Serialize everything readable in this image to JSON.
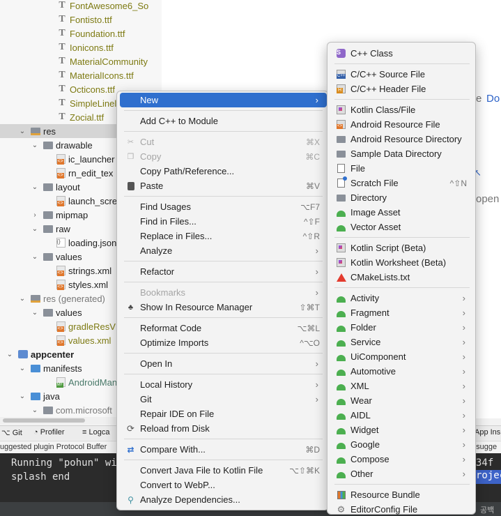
{
  "tree": {
    "rows": [
      {
        "label": "FontAwesome6_So",
        "icon": "font-file-icon",
        "style": "olive"
      },
      {
        "label": "Fontisto.ttf",
        "icon": "font-file-icon",
        "style": "olive"
      },
      {
        "label": "Foundation.ttf",
        "icon": "font-file-icon",
        "style": "olive"
      },
      {
        "label": "Ionicons.ttf",
        "icon": "font-file-icon",
        "style": "olive"
      },
      {
        "label": "MaterialCommunity",
        "icon": "font-file-icon",
        "style": "olive"
      },
      {
        "label": "MaterialIcons.ttf",
        "icon": "font-file-icon",
        "style": "olive"
      },
      {
        "label": "Octicons.ttf",
        "icon": "font-file-icon",
        "style": "olive"
      },
      {
        "label": "SimpleLinel",
        "icon": "font-file-icon",
        "style": "olive"
      },
      {
        "label": "Zocial.ttf",
        "icon": "font-file-icon",
        "style": "olive"
      },
      {
        "label": "res",
        "icon": "res-folder-icon",
        "style": "",
        "expanded": true,
        "selected": true
      },
      {
        "label": "drawable",
        "icon": "folder-icon",
        "style": "",
        "expanded": true
      },
      {
        "label": "ic_launcher",
        "icon": "xml-file-icon",
        "style": ""
      },
      {
        "label": "rn_edit_tex",
        "icon": "xml-file-icon",
        "style": ""
      },
      {
        "label": "layout",
        "icon": "folder-icon",
        "style": "",
        "expanded": true
      },
      {
        "label": "launch_scre",
        "icon": "xml-file-icon",
        "style": ""
      },
      {
        "label": "mipmap",
        "icon": "folder-icon",
        "style": "",
        "expanded": false
      },
      {
        "label": "raw",
        "icon": "folder-icon",
        "style": "",
        "expanded": true
      },
      {
        "label": "loading.json",
        "icon": "json-file-icon",
        "style": ""
      },
      {
        "label": "values",
        "icon": "folder-icon",
        "style": "",
        "expanded": true
      },
      {
        "label": "strings.xml",
        "icon": "xml-file-icon",
        "style": ""
      },
      {
        "label": "styles.xml",
        "icon": "xml-file-icon",
        "style": ""
      },
      {
        "label": "res (generated)",
        "icon": "res-folder-icon",
        "style": "mute",
        "expanded": true
      },
      {
        "label": "values",
        "icon": "folder-icon",
        "style": "",
        "expanded": true
      },
      {
        "label": "gradleResV",
        "icon": "xml-file-icon",
        "style": "olive"
      },
      {
        "label": "values.xml",
        "icon": "xml-file-icon",
        "style": "olive"
      },
      {
        "label": "appcenter",
        "icon": "module-icon",
        "style": "bold",
        "expanded": true
      },
      {
        "label": "manifests",
        "icon": "folder-blue-icon",
        "style": "",
        "expanded": true
      },
      {
        "label": "AndroidManife",
        "icon": "manifest-file-icon",
        "style": "teal"
      },
      {
        "label": "java",
        "icon": "folder-blue-icon",
        "style": "",
        "expanded": true
      },
      {
        "label": "com.microsoft",
        "icon": "folder-icon",
        "style": "mute",
        "expanded": true
      }
    ]
  },
  "editor": {
    "fragments": [
      "re",
      "Do",
      "open"
    ]
  },
  "toolbar": {
    "git": "Git",
    "profiler": "Profiler",
    "logcat": "Logca",
    "app_inspection": "App Ins"
  },
  "plugin_bar": {
    "left": "uggested plugin Protocol Buffer",
    "right": "t sugge"
  },
  "terminal": {
    "line1": "Running \"pohun\" wit",
    "line1_right": "34f",
    "line2": "splash end",
    "line2_right": "rojec"
  },
  "status": {
    "right": "공백"
  },
  "context_menu": {
    "items": [
      {
        "label": "New",
        "submenu": true,
        "highlighted": true
      },
      {
        "separator": true
      },
      {
        "label": "Add C++ to Module"
      },
      {
        "separator": true
      },
      {
        "label": "Cut",
        "shortcut": "⌘X",
        "disabled": true,
        "icon": "cut-icon"
      },
      {
        "label": "Copy",
        "shortcut": "⌘C",
        "disabled": true,
        "icon": "copy-icon"
      },
      {
        "label": "Copy Path/Reference..."
      },
      {
        "label": "Paste",
        "shortcut": "⌘V",
        "icon": "paste-icon"
      },
      {
        "separator": true
      },
      {
        "label": "Find Usages",
        "shortcut": "⌥F7"
      },
      {
        "label": "Find in Files...",
        "shortcut": "^⇧F"
      },
      {
        "label": "Replace in Files...",
        "shortcut": "^⇧R"
      },
      {
        "label": "Analyze",
        "submenu": true
      },
      {
        "separator": true
      },
      {
        "label": "Refactor",
        "submenu": true
      },
      {
        "separator": true
      },
      {
        "label": "Bookmarks",
        "submenu": true,
        "disabled": true
      },
      {
        "label": "Show In Resource Manager",
        "shortcut": "⇧⌘T",
        "icon": "resource-manager-icon"
      },
      {
        "separator": true
      },
      {
        "label": "Reformat Code",
        "shortcut": "⌥⌘L"
      },
      {
        "label": "Optimize Imports",
        "shortcut": "^⌥O"
      },
      {
        "separator": true
      },
      {
        "label": "Open In",
        "submenu": true
      },
      {
        "separator": true
      },
      {
        "label": "Local History",
        "submenu": true
      },
      {
        "label": "Git",
        "submenu": true
      },
      {
        "label": "Repair IDE on File"
      },
      {
        "label": "Reload from Disk",
        "icon": "reload-icon"
      },
      {
        "separator": true
      },
      {
        "label": "Compare With...",
        "shortcut": "⌘D",
        "icon": "compare-icon"
      },
      {
        "separator": true
      },
      {
        "label": "Convert Java File to Kotlin File",
        "shortcut": "⌥⇧⌘K"
      },
      {
        "label": "Convert to WebP..."
      },
      {
        "label": "Analyze Dependencies...",
        "icon": "dependencies-icon"
      }
    ]
  },
  "new_menu": {
    "items": [
      {
        "label": "C++ Class",
        "icon": "cpp-class-icon"
      },
      {
        "separator": true
      },
      {
        "label": "C/C++ Source File",
        "icon": "cpp-source-icon"
      },
      {
        "label": "C/C++ Header File",
        "icon": "cpp-header-icon"
      },
      {
        "separator": true
      },
      {
        "label": "Kotlin Class/File",
        "icon": "kotlin-file-icon"
      },
      {
        "label": "Android Resource File",
        "icon": "android-resource-file-icon"
      },
      {
        "label": "Android Resource Directory",
        "icon": "folder-icon"
      },
      {
        "label": "Sample Data Directory",
        "icon": "folder-icon"
      },
      {
        "label": "File",
        "icon": "file-icon"
      },
      {
        "label": "Scratch File",
        "shortcut": "^⇧N",
        "icon": "scratch-file-icon"
      },
      {
        "label": "Directory",
        "icon": "folder-icon"
      },
      {
        "label": "Image Asset",
        "icon": "android-icon"
      },
      {
        "label": "Vector Asset",
        "icon": "android-icon"
      },
      {
        "separator": true
      },
      {
        "label": "Kotlin Script (Beta)",
        "icon": "kotlin-file-icon"
      },
      {
        "label": "Kotlin Worksheet (Beta)",
        "icon": "kotlin-file-icon"
      },
      {
        "label": "CMakeLists.txt",
        "icon": "cmake-icon"
      },
      {
        "separator": true
      },
      {
        "label": "Activity",
        "submenu": true,
        "icon": "android-icon"
      },
      {
        "label": "Fragment",
        "submenu": true,
        "icon": "android-icon"
      },
      {
        "label": "Folder",
        "submenu": true,
        "icon": "android-icon"
      },
      {
        "label": "Service",
        "submenu": true,
        "icon": "android-icon"
      },
      {
        "label": "UiComponent",
        "submenu": true,
        "icon": "android-icon"
      },
      {
        "label": "Automotive",
        "submenu": true,
        "icon": "android-icon"
      },
      {
        "label": "XML",
        "submenu": true,
        "icon": "android-icon"
      },
      {
        "label": "Wear",
        "submenu": true,
        "icon": "android-icon"
      },
      {
        "label": "AIDL",
        "submenu": true,
        "icon": "android-icon"
      },
      {
        "label": "Widget",
        "submenu": true,
        "icon": "android-icon"
      },
      {
        "label": "Google",
        "submenu": true,
        "icon": "android-icon"
      },
      {
        "label": "Compose",
        "submenu": true,
        "icon": "android-icon"
      },
      {
        "label": "Other",
        "submenu": true,
        "icon": "android-icon"
      },
      {
        "separator": true
      },
      {
        "label": "Resource Bundle",
        "icon": "resource-bundle-icon"
      },
      {
        "label": "EditorConfig File",
        "icon": "gear-icon"
      }
    ]
  },
  "colors": {
    "highlight": "#2f6fce",
    "olive_text": "#7d7a12",
    "terminal_bg": "#2b2b2b"
  }
}
